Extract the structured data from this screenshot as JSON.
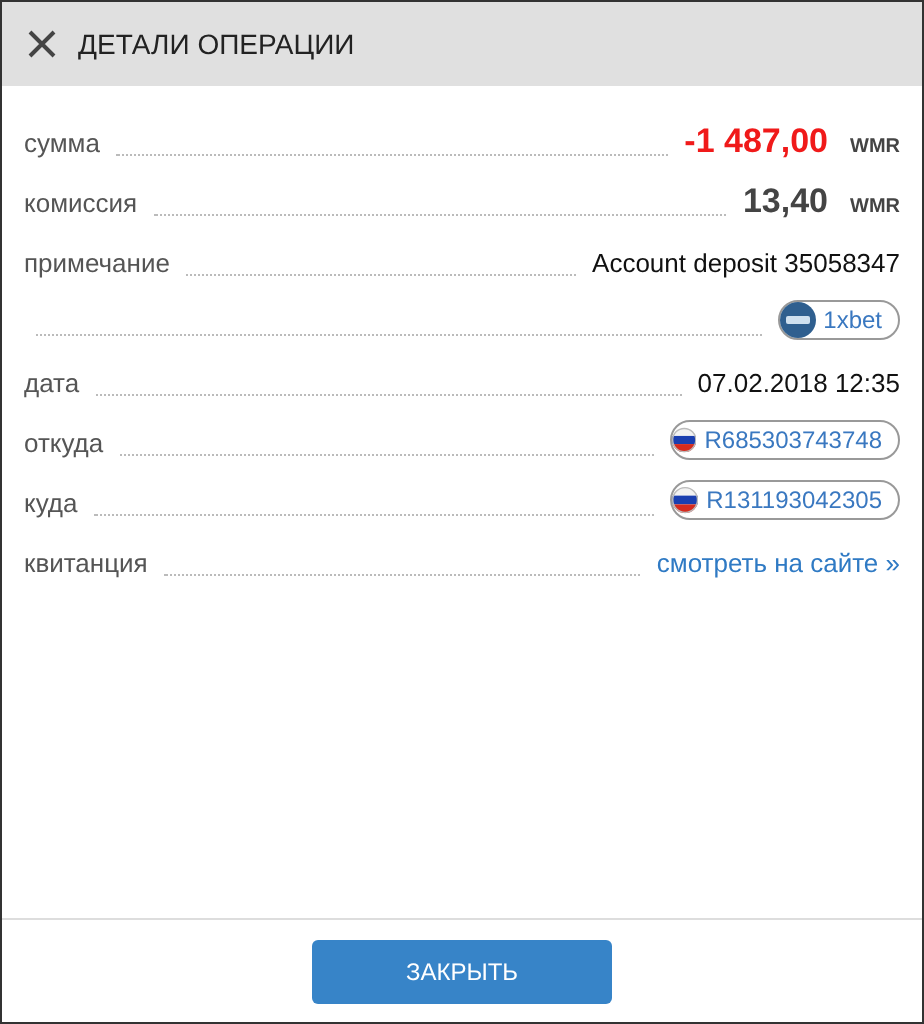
{
  "window": {
    "title": "ДЕТАЛИ ОПЕРАЦИИ"
  },
  "rows": [
    {
      "kind": "amount",
      "label": "сумма",
      "value": "-1 487,00",
      "currency": "WMR",
      "negative": true
    },
    {
      "kind": "amount",
      "label": "комиссия",
      "value": "13,40",
      "currency": "WMR",
      "negative": false
    },
    {
      "kind": "text",
      "label": "примечание",
      "value": "Account deposit 35058347"
    },
    {
      "kind": "logo_chip",
      "value": "1xbet"
    },
    {
      "kind": "text",
      "label": "дата",
      "value": "07.02.2018 12:35"
    },
    {
      "kind": "flag_chip",
      "label": "откуда",
      "value": "R685303743748"
    },
    {
      "kind": "flag_chip",
      "label": "куда",
      "value": "R131193042305"
    },
    {
      "kind": "link",
      "label": "квитанция",
      "value": "смотреть на сайте »"
    }
  ],
  "buttons": [
    {
      "label": "ЗАКРЫТЬ"
    }
  ]
}
